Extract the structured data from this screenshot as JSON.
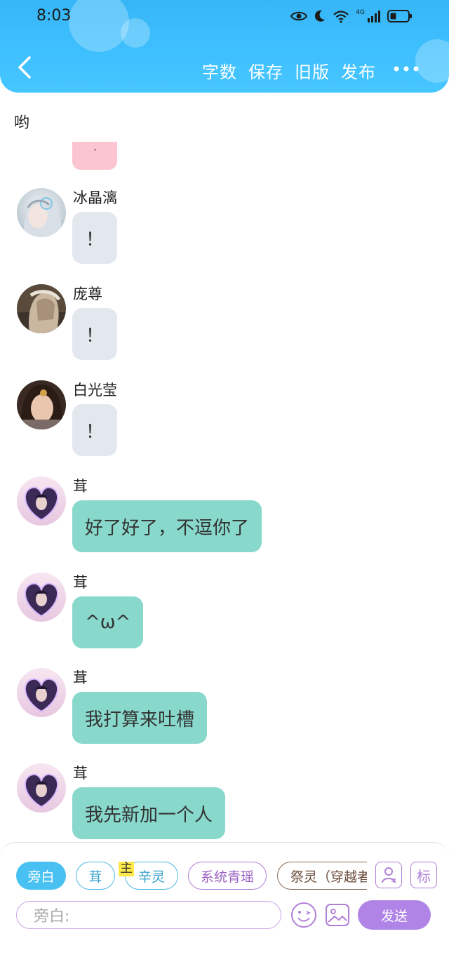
{
  "status_bar": {
    "time": "8:03",
    "network": "4G"
  },
  "header": {
    "actions": [
      "字数",
      "保存",
      "旧版",
      "发布"
    ],
    "more": "•••"
  },
  "chat": {
    "top_text": "哟",
    "partial_bubble_text": "·",
    "messages": [
      {
        "name": "冰晶漓",
        "text": "！",
        "style": "gray"
      },
      {
        "name": "庞尊",
        "text": "！",
        "style": "gray"
      },
      {
        "name": "白光莹",
        "text": "！",
        "style": "gray"
      },
      {
        "name": "茸",
        "text": "好了好了，不逗你了",
        "style": "teal"
      },
      {
        "name": "茸",
        "text": "^ω^",
        "style": "teal"
      },
      {
        "name": "茸",
        "text": "我打算来吐槽",
        "style": "teal"
      },
      {
        "name": "茸",
        "text": "我先新加一个人",
        "style": "teal"
      }
    ]
  },
  "panel": {
    "roles": [
      "旁白",
      "茸",
      "辛灵",
      "系统青瑶",
      "祭灵（穿越者）"
    ],
    "main_tag": "主",
    "icon_label": "标",
    "input_placeholder": "旁白:",
    "send_label": "发送"
  },
  "colors": {
    "header": "#3fc0ff",
    "gray_bubble": "#e3e7ee",
    "teal_bubble": "#88d8cb",
    "pink_bubble": "#fbc5d1",
    "send_button": "#b083e6",
    "active_role": "#48c1f2"
  }
}
